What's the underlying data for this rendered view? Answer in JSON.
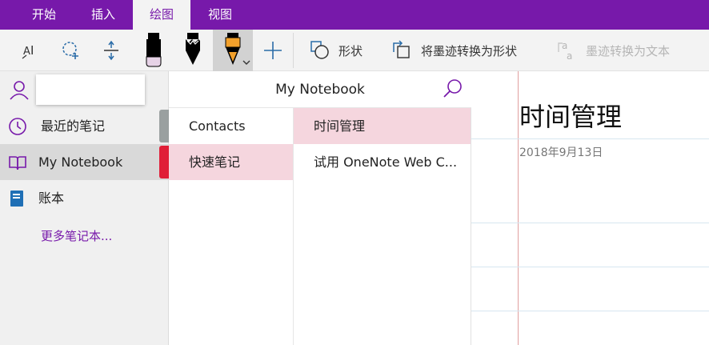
{
  "ribbon": {
    "tabs": [
      {
        "label": "开始"
      },
      {
        "label": "插入"
      },
      {
        "label": "绘图"
      },
      {
        "label": "视图"
      }
    ],
    "active_tab": "绘图"
  },
  "toolbar": {
    "shape_label": "形状",
    "ink_to_shape_label": "将墨迹转换为形状",
    "ink_to_text_label": "墨迹转换为文本",
    "pen_colors": {
      "black_marker": "#000000",
      "black_pen": "#000000",
      "orange_pen": "#f2a02b"
    }
  },
  "sidebar": {
    "items": [
      {
        "label": "最近的笔记",
        "icon": "clock-icon"
      },
      {
        "label": "My Notebook",
        "icon": "book-open-icon",
        "color": "#e01e37"
      },
      {
        "label": "账本",
        "icon": "notebook-icon",
        "color": "#1f6fb5"
      }
    ],
    "more_label": "更多笔记本..."
  },
  "notebook": {
    "title": "My Notebook",
    "sections": [
      {
        "label": "Contacts"
      },
      {
        "label": "快速笔记"
      }
    ],
    "pages": [
      {
        "label": "时间管理"
      },
      {
        "label": "试用 OneNote Web C..."
      }
    ]
  },
  "page": {
    "title": "时间管理",
    "date": "2018年9月13日"
  },
  "colors": {
    "accent": "#7719aa",
    "selection_pink": "#f5d6de"
  }
}
